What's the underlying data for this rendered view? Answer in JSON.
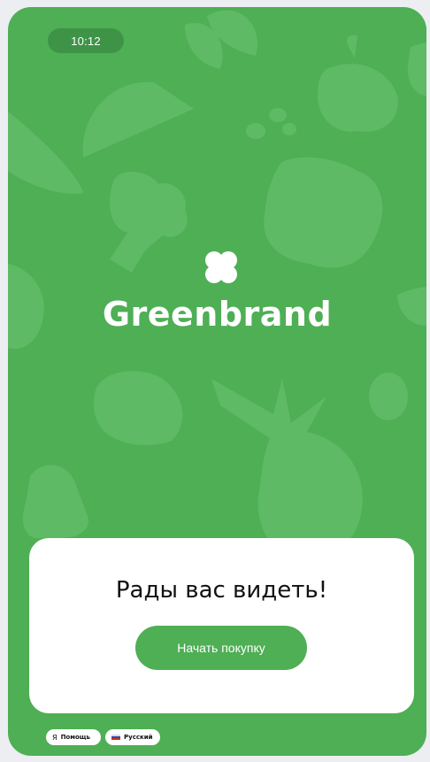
{
  "status_bar": {
    "time": "10:12"
  },
  "brand": {
    "name": "Greenbrand",
    "logo_icon": "four-petal-flower-icon"
  },
  "welcome_card": {
    "title": "Рады вас видеть!",
    "start_button_label": "Начать покупку"
  },
  "footer": {
    "help": {
      "label": "Помощь",
      "icon": "ya-letter-icon",
      "glyph": "Я"
    },
    "language": {
      "label": "Русский",
      "icon": "russian-flag-icon"
    }
  },
  "colors": {
    "primary_green": "#4eaf55",
    "shape_green": "#6cc373",
    "card_white": "#ffffff",
    "page_bg": "#eceef1"
  }
}
